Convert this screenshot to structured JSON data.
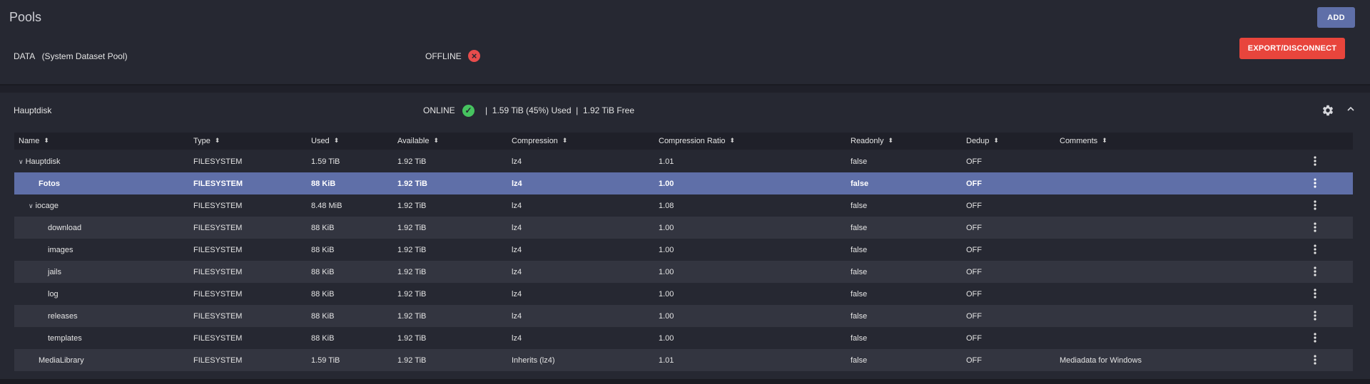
{
  "page": {
    "title": "Pools",
    "add_label": "ADD"
  },
  "pool_offline": {
    "name": "DATA   (System Dataset Pool)",
    "status": "OFFLINE",
    "status_icon": "error-x-icon",
    "status_color": "#e84c4c",
    "export_label": "EXPORT/DISCONNECT"
  },
  "pool_online": {
    "name": "Hauptdisk",
    "status": "ONLINE",
    "status_icon": "check-circle-icon",
    "status_color": "#46c35f",
    "usage": "|  1.59 TiB (45%) Used  |  1.92 TiB Free"
  },
  "table": {
    "columns": [
      "Name",
      "Type",
      "Used",
      "Available",
      "Compression",
      "Compression Ratio",
      "Readonly",
      "Dedup",
      "Comments"
    ],
    "rows": [
      {
        "name": "Hauptdisk",
        "type": "FILESYSTEM",
        "used": "1.59 TiB",
        "available": "1.92 TiB",
        "compression": "lz4",
        "ratio": "1.01",
        "readonly": "false",
        "dedup": "OFF",
        "comments": ""
      },
      {
        "name": "Fotos",
        "type": "FILESYSTEM",
        "used": "88 KiB",
        "available": "1.92 TiB",
        "compression": "lz4",
        "ratio": "1.00",
        "readonly": "false",
        "dedup": "OFF",
        "comments": ""
      },
      {
        "name": "iocage",
        "type": "FILESYSTEM",
        "used": "8.48 MiB",
        "available": "1.92 TiB",
        "compression": "lz4",
        "ratio": "1.08",
        "readonly": "false",
        "dedup": "OFF",
        "comments": ""
      },
      {
        "name": "download",
        "type": "FILESYSTEM",
        "used": "88 KiB",
        "available": "1.92 TiB",
        "compression": "lz4",
        "ratio": "1.00",
        "readonly": "false",
        "dedup": "OFF",
        "comments": ""
      },
      {
        "name": "images",
        "type": "FILESYSTEM",
        "used": "88 KiB",
        "available": "1.92 TiB",
        "compression": "lz4",
        "ratio": "1.00",
        "readonly": "false",
        "dedup": "OFF",
        "comments": ""
      },
      {
        "name": "jails",
        "type": "FILESYSTEM",
        "used": "88 KiB",
        "available": "1.92 TiB",
        "compression": "lz4",
        "ratio": "1.00",
        "readonly": "false",
        "dedup": "OFF",
        "comments": ""
      },
      {
        "name": "log",
        "type": "FILESYSTEM",
        "used": "88 KiB",
        "available": "1.92 TiB",
        "compression": "lz4",
        "ratio": "1.00",
        "readonly": "false",
        "dedup": "OFF",
        "comments": ""
      },
      {
        "name": "releases",
        "type": "FILESYSTEM",
        "used": "88 KiB",
        "available": "1.92 TiB",
        "compression": "lz4",
        "ratio": "1.00",
        "readonly": "false",
        "dedup": "OFF",
        "comments": ""
      },
      {
        "name": "templates",
        "type": "FILESYSTEM",
        "used": "88 KiB",
        "available": "1.92 TiB",
        "compression": "lz4",
        "ratio": "1.00",
        "readonly": "false",
        "dedup": "OFF",
        "comments": ""
      },
      {
        "name": "MediaLibrary",
        "type": "FILESYSTEM",
        "used": "1.59 TiB",
        "available": "1.92 TiB",
        "compression": "Inherits (lz4)",
        "ratio": "1.01",
        "readonly": "false",
        "dedup": "OFF",
        "comments": "Mediadata for Windows"
      }
    ]
  },
  "colors": {
    "accent": "#5f6fa8",
    "danger": "#e8453c",
    "background": "#1f2029",
    "card": "#262832"
  }
}
